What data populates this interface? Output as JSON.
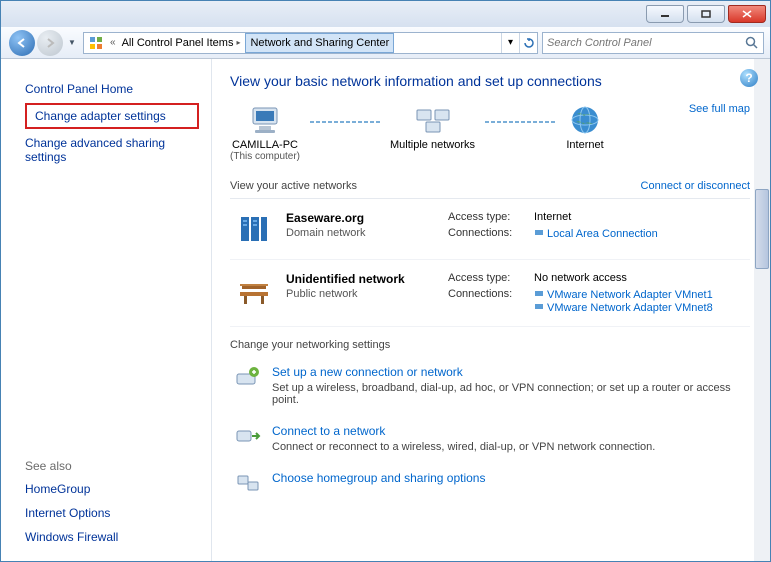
{
  "titlebar": {},
  "nav": {
    "breadcrumb_prefix": "«",
    "crumb1": "All Control Panel Items",
    "crumb2": "Network and Sharing Center"
  },
  "search": {
    "placeholder": "Search Control Panel"
  },
  "sidebar": {
    "home": "Control Panel Home",
    "change_adapter": "Change adapter settings",
    "change_advanced": "Change advanced sharing settings",
    "seealso_hdr": "See also",
    "homegroup": "HomeGroup",
    "internet_options": "Internet Options",
    "firewall": "Windows Firewall"
  },
  "main": {
    "heading": "View your basic network information and set up connections",
    "diagram": {
      "node1": "CAMILLA-PC",
      "node1_sub": "(This computer)",
      "node2": "Multiple networks",
      "node3": "Internet",
      "fullmap": "See full map"
    },
    "active_hdr": "View your active networks",
    "connect_link": "Connect or disconnect",
    "net1": {
      "name": "Easeware.org",
      "type": "Domain network",
      "access_lbl": "Access type:",
      "access_val": "Internet",
      "conn_lbl": "Connections:",
      "conn1": "Local Area Connection"
    },
    "net2": {
      "name": "Unidentified network",
      "type": "Public network",
      "access_lbl": "Access type:",
      "access_val": "No network access",
      "conn_lbl": "Connections:",
      "conn1": "VMware Network Adapter VMnet1",
      "conn2": "VMware Network Adapter VMnet8"
    },
    "settings_hdr": "Change your networking settings",
    "set1": {
      "title": "Set up a new connection or network",
      "desc": "Set up a wireless, broadband, dial-up, ad hoc, or VPN connection; or set up a router or access point."
    },
    "set2": {
      "title": "Connect to a network",
      "desc": "Connect or reconnect to a wireless, wired, dial-up, or VPN network connection."
    },
    "set3": {
      "title": "Choose homegroup and sharing options"
    }
  }
}
